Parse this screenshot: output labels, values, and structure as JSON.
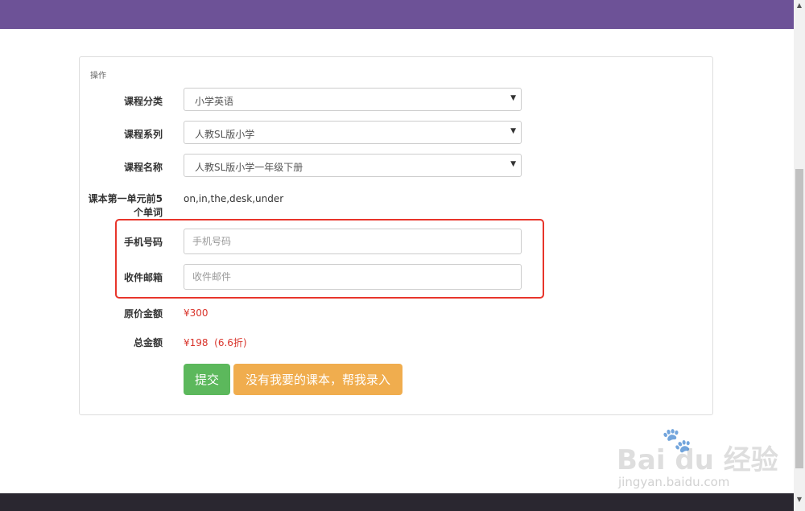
{
  "panel": {
    "title": "操作"
  },
  "form": {
    "course_category": {
      "label": "课程分类",
      "value": "小学英语"
    },
    "course_series": {
      "label": "课程系列",
      "value": "人教SL版小学"
    },
    "course_name": {
      "label": "课程名称",
      "value": "人教SL版小学一年级下册"
    },
    "words": {
      "label_line1": "课本第一单元前5",
      "label_line2": "个单词",
      "value": "on,in,the,desk,under"
    },
    "phone": {
      "label": "手机号码",
      "placeholder": "手机号码",
      "value": ""
    },
    "email": {
      "label": "收件邮箱",
      "placeholder": "收件邮件",
      "value": ""
    },
    "original_price": {
      "label": "原价金额",
      "value": "¥300"
    },
    "total_price": {
      "label": "总金额",
      "value": "¥198  (6.6折)"
    }
  },
  "buttons": {
    "submit": "提交",
    "request_textbook": "没有我要的课本，帮我录入"
  },
  "watermark": {
    "logo": "Bai  du 经验",
    "url": "jingyan.baidu.com"
  },
  "colors": {
    "topbar": "#6d5297",
    "submit": "#5cb85c",
    "request": "#f0ad4e",
    "price": "#d9342b",
    "highlight": "#e8352b"
  },
  "icons": {
    "dropdown_caret": "▼",
    "scroll_up": "▲",
    "scroll_down": "▼",
    "watermark_paw": "🐾"
  }
}
